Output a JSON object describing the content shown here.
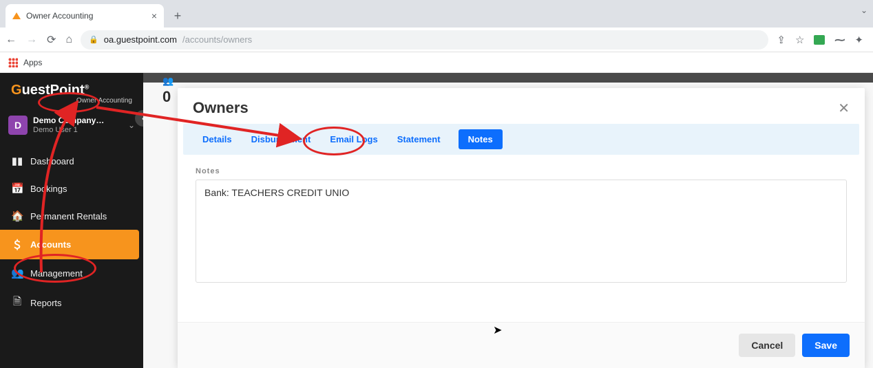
{
  "browser": {
    "tab_title": "Owner Accounting",
    "url_host": "oa.guestpoint.com",
    "url_path": "/accounts/owners",
    "apps_label": "Apps"
  },
  "sidebar": {
    "brand_prefix": "G",
    "brand_rest": "uestPoint",
    "brand_sub": "Owner Accounting",
    "company_initial": "D",
    "company_name": "Demo Company…",
    "user_name": "Demo User 1",
    "items": [
      {
        "label": "Dashboard",
        "icon": "bar-chart"
      },
      {
        "label": "Bookings",
        "icon": "calendar"
      },
      {
        "label": "Permanent Rentals",
        "icon": "house"
      },
      {
        "label": "Accounts",
        "icon": "dollar"
      },
      {
        "label": "Management",
        "icon": "users"
      },
      {
        "label": "Reports",
        "icon": "document"
      }
    ],
    "active_index": 3
  },
  "main": {
    "count_fragment": "0"
  },
  "modal": {
    "title": "Owners",
    "tabs": [
      "Details",
      "Disbursement",
      "Email Logs",
      "Statement",
      "Notes"
    ],
    "active_tab_index": 4,
    "notes_label": "Notes",
    "notes_value": "Bank: TEACHERS CREDIT UNIO",
    "cancel_label": "Cancel",
    "save_label": "Save"
  }
}
